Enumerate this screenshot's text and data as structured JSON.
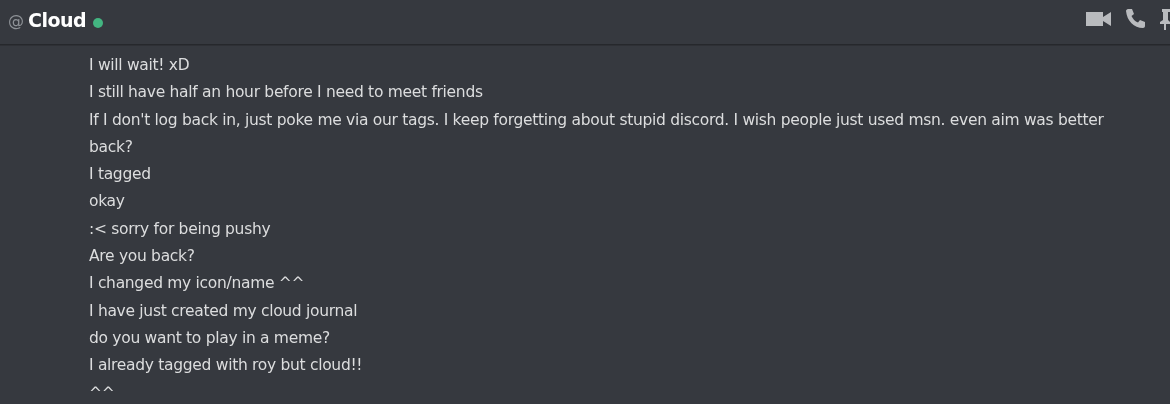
{
  "header": {
    "prefix": "@",
    "title": "Cloud",
    "online": true
  },
  "messages": [
    "I will wait! xD",
    "I still have half an hour before I need to meet friends",
    "If I don't log back in, just poke me via our tags. I keep forgetting about stupid discord. I wish people just used msn. even aim was better",
    "back?",
    "I tagged",
    "okay",
    ":< sorry for being pushy",
    "Are you back?",
    "I changed my icon/name ^^",
    "I have just created my cloud journal",
    "do you want to play in a meme?",
    "I already tagged with roy but cloud!!",
    "^^"
  ]
}
